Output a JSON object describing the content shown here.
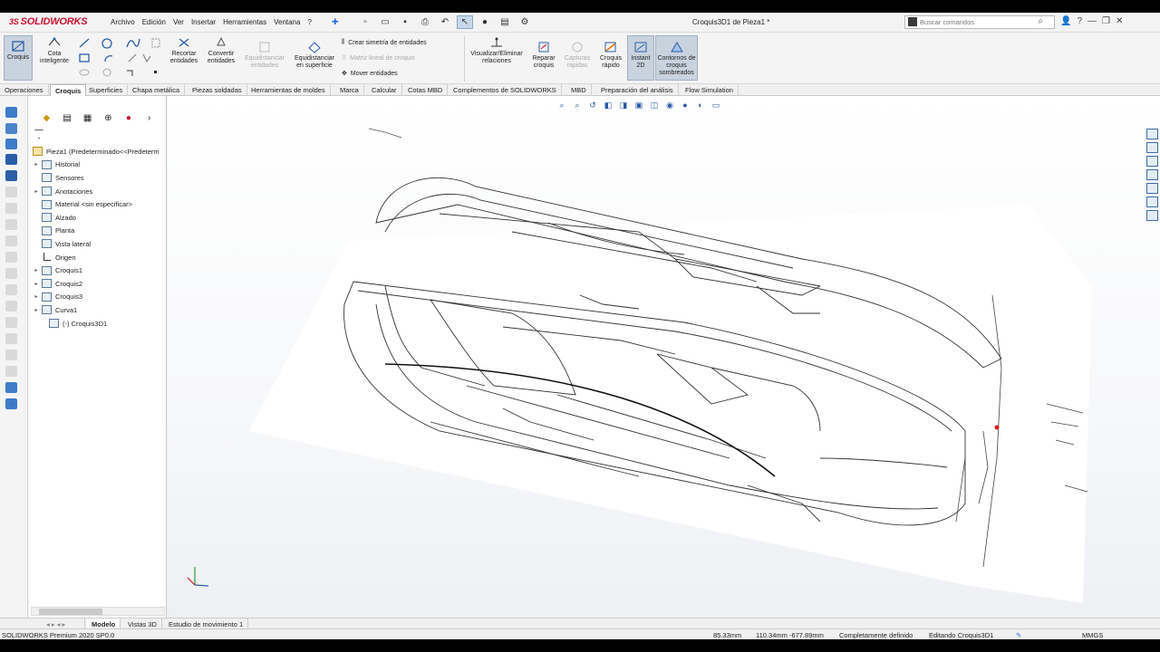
{
  "app": {
    "logo": "SOLIDWORKS",
    "doc_title": "Croquis3D1 de Pieza1 *"
  },
  "menu": [
    "Archivo",
    "Edición",
    "Ver",
    "Insertar",
    "Herramientas",
    "Ventana",
    "?"
  ],
  "search": {
    "placeholder": "Buscar comandos"
  },
  "ribbon": {
    "croquis": "Croquis",
    "cota": "Cota inteligente",
    "recortar": "Recortar entidades",
    "convertir": "Convertir entidades",
    "equid_ent": "Equidistanciar entidades",
    "equid_sup": "Equidistanciar en superficie",
    "simetria": "Crear simetría de entidades",
    "matriz": "Matriz lineal de croquis",
    "mover": "Mover entidades",
    "visualizar": "Visualizar/Eliminar relaciones",
    "reparar": "Reparar croquis",
    "capturas": "Capturas rápidas",
    "rapido": "Croquis rápido",
    "instant": "Instant 2D",
    "contornos": "Contornos de croquis sombreados"
  },
  "tabs": [
    "Operaciones",
    "Croquis",
    "Superficies",
    "Chapa metálica",
    "Piezas soldadas",
    "Herramientas de moldes",
    "Marca",
    "Calcular",
    "Cotas MBD",
    "Complementos de SOLIDWORKS",
    "MBD",
    "Preparación del análisis",
    "Flow Simulation"
  ],
  "tree": {
    "root": "Pieza1  (Predeterminado<<Predeterm",
    "items": [
      {
        "label": "Historial",
        "exp": "▸"
      },
      {
        "label": "Sensores",
        "exp": ""
      },
      {
        "label": "Anotaciones",
        "exp": "▸"
      },
      {
        "label": "Material <sin especificar>",
        "exp": ""
      },
      {
        "label": "Alzado",
        "exp": ""
      },
      {
        "label": "Planta",
        "exp": ""
      },
      {
        "label": "Vista lateral",
        "exp": ""
      },
      {
        "label": "Origen",
        "exp": ""
      },
      {
        "label": "Croquis1",
        "exp": "▸"
      },
      {
        "label": "Croquis2",
        "exp": "▸"
      },
      {
        "label": "Croquis3",
        "exp": "▸"
      },
      {
        "label": "Curva1",
        "exp": "▸"
      },
      {
        "label": "(-) Croquis3D1",
        "exp": ""
      }
    ]
  },
  "bottom_tabs": [
    "Modelo",
    "Vistas 3D",
    "Estudio de movimiento 1"
  ],
  "status": {
    "version": "SOLIDWORKS Premium 2020 SP0.0",
    "coord1": "85.33mm",
    "coord2": "110.34mm -677.89mm",
    "state": "Completamente definido",
    "edit": "Editando Croquis3D1",
    "units": "MMGS"
  },
  "colors": {
    "accent": "#c8102e",
    "selection": "#c9d3de",
    "link": "#2a6bd6"
  }
}
